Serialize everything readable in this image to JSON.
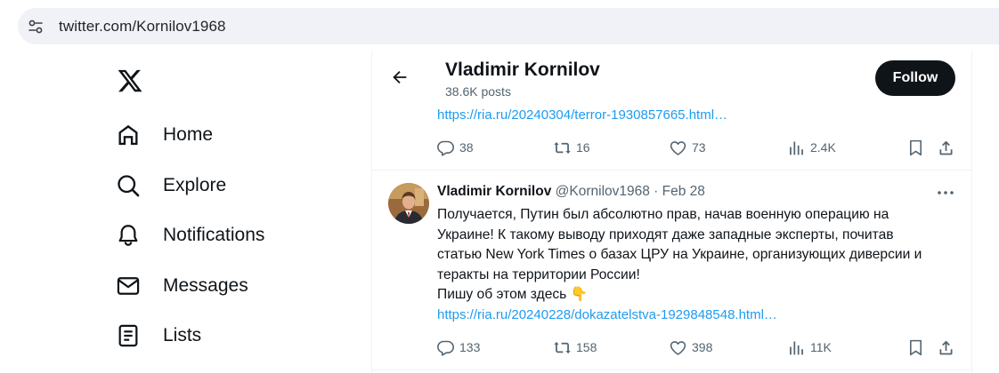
{
  "browser": {
    "url": "twitter.com/Kornilov1968"
  },
  "nav": {
    "items": [
      {
        "label": "Home"
      },
      {
        "label": "Explore"
      },
      {
        "label": "Notifications"
      },
      {
        "label": "Messages"
      },
      {
        "label": "Lists"
      }
    ]
  },
  "header": {
    "name": "Vladimir Kornilov",
    "posts": "38.6K posts",
    "follow_label": "Follow"
  },
  "tweet1": {
    "link": "https://ria.ru/20240304/terror-1930857665.html…",
    "replies": "38",
    "reposts": "16",
    "likes": "73",
    "views": "2.4K"
  },
  "tweet2": {
    "name": "Vladimir Kornilov",
    "handle_date": "@Kornilov1968 · Feb 28",
    "lines": [
      "Получается, Путин был абсолютно прав, начав военную операцию на",
      "Украине! К такому выводу приходят даже западные эксперты, почитав",
      "статью New York Times о базах ЦРУ на Украине, организующих диверсии и",
      "теракты на территории России!",
      "Пишу об этом здесь 👇"
    ],
    "link": "https://ria.ru/20240228/dokazatelstva-1929848548.html…",
    "replies": "133",
    "reposts": "158",
    "likes": "398",
    "views": "11K"
  },
  "colors": {
    "accent": "#1d9bf0",
    "text": "#0f1419",
    "muted": "#536471"
  }
}
